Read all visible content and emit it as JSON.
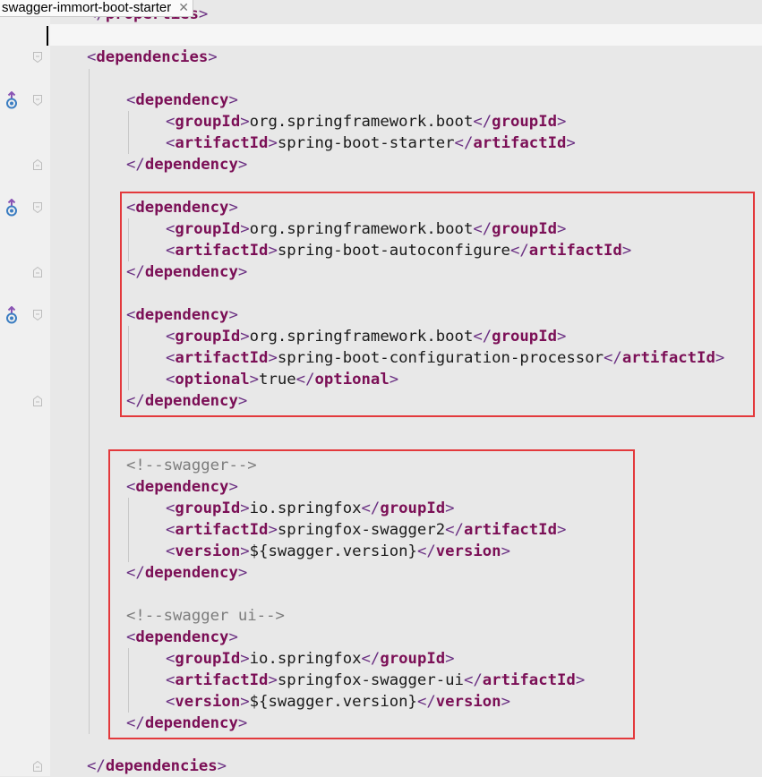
{
  "window": {
    "tab_title": "swagger-immort-boot-starter",
    "close_glyph": "✕"
  },
  "editor": {
    "colors": {
      "bracket": "#6a2f82",
      "tag": "#7b0f56",
      "comment": "#7c7c7c",
      "highlight_box": "#e3393c"
    },
    "lines": [
      {
        "indent": 0,
        "segments": [
          {
            "k": "b",
            "v": "</"
          },
          {
            "k": "t",
            "v": "properties"
          },
          {
            "k": "b",
            "v": ">"
          }
        ]
      },
      {
        "indent": 0,
        "segments": []
      },
      {
        "indent": 0,
        "segments": [
          {
            "k": "b",
            "v": "<"
          },
          {
            "k": "t",
            "v": "dependencies"
          },
          {
            "k": "b",
            "v": ">"
          }
        ]
      },
      {
        "indent": 0,
        "segments": []
      },
      {
        "indent": 1,
        "segments": [
          {
            "k": "b",
            "v": "<"
          },
          {
            "k": "t",
            "v": "dependency"
          },
          {
            "k": "b",
            "v": ">"
          }
        ]
      },
      {
        "indent": 2,
        "segments": [
          {
            "k": "b",
            "v": "<"
          },
          {
            "k": "t",
            "v": "groupId"
          },
          {
            "k": "b",
            "v": ">"
          },
          {
            "k": "x",
            "v": "org.springframework.boot"
          },
          {
            "k": "b",
            "v": "</"
          },
          {
            "k": "t",
            "v": "groupId"
          },
          {
            "k": "b",
            "v": ">"
          }
        ]
      },
      {
        "indent": 2,
        "segments": [
          {
            "k": "b",
            "v": "<"
          },
          {
            "k": "t",
            "v": "artifactId"
          },
          {
            "k": "b",
            "v": ">"
          },
          {
            "k": "x",
            "v": "spring-boot-starter"
          },
          {
            "k": "b",
            "v": "</"
          },
          {
            "k": "t",
            "v": "artifactId"
          },
          {
            "k": "b",
            "v": ">"
          }
        ]
      },
      {
        "indent": 1,
        "segments": [
          {
            "k": "b",
            "v": "</"
          },
          {
            "k": "t",
            "v": "dependency"
          },
          {
            "k": "b",
            "v": ">"
          }
        ]
      },
      {
        "indent": 0,
        "segments": []
      },
      {
        "indent": 1,
        "segments": [
          {
            "k": "b",
            "v": "<"
          },
          {
            "k": "t",
            "v": "dependency"
          },
          {
            "k": "b",
            "v": ">"
          }
        ]
      },
      {
        "indent": 2,
        "segments": [
          {
            "k": "b",
            "v": "<"
          },
          {
            "k": "t",
            "v": "groupId"
          },
          {
            "k": "b",
            "v": ">"
          },
          {
            "k": "x",
            "v": "org.springframework.boot"
          },
          {
            "k": "b",
            "v": "</"
          },
          {
            "k": "t",
            "v": "groupId"
          },
          {
            "k": "b",
            "v": ">"
          }
        ]
      },
      {
        "indent": 2,
        "segments": [
          {
            "k": "b",
            "v": "<"
          },
          {
            "k": "t",
            "v": "artifactId"
          },
          {
            "k": "b",
            "v": ">"
          },
          {
            "k": "x",
            "v": "spring-boot-autoconfigure"
          },
          {
            "k": "b",
            "v": "</"
          },
          {
            "k": "t",
            "v": "artifactId"
          },
          {
            "k": "b",
            "v": ">"
          }
        ]
      },
      {
        "indent": 1,
        "segments": [
          {
            "k": "b",
            "v": "</"
          },
          {
            "k": "t",
            "v": "dependency"
          },
          {
            "k": "b",
            "v": ">"
          }
        ]
      },
      {
        "indent": 0,
        "segments": []
      },
      {
        "indent": 1,
        "segments": [
          {
            "k": "b",
            "v": "<"
          },
          {
            "k": "t",
            "v": "dependency"
          },
          {
            "k": "b",
            "v": ">"
          }
        ]
      },
      {
        "indent": 2,
        "segments": [
          {
            "k": "b",
            "v": "<"
          },
          {
            "k": "t",
            "v": "groupId"
          },
          {
            "k": "b",
            "v": ">"
          },
          {
            "k": "x",
            "v": "org.springframework.boot"
          },
          {
            "k": "b",
            "v": "</"
          },
          {
            "k": "t",
            "v": "groupId"
          },
          {
            "k": "b",
            "v": ">"
          }
        ]
      },
      {
        "indent": 2,
        "segments": [
          {
            "k": "b",
            "v": "<"
          },
          {
            "k": "t",
            "v": "artifactId"
          },
          {
            "k": "b",
            "v": ">"
          },
          {
            "k": "x",
            "v": "spring-boot-configuration-processor"
          },
          {
            "k": "b",
            "v": "</"
          },
          {
            "k": "t",
            "v": "artifactId"
          },
          {
            "k": "b",
            "v": ">"
          }
        ]
      },
      {
        "indent": 2,
        "segments": [
          {
            "k": "b",
            "v": "<"
          },
          {
            "k": "t",
            "v": "optional"
          },
          {
            "k": "b",
            "v": ">"
          },
          {
            "k": "x",
            "v": "true"
          },
          {
            "k": "b",
            "v": "</"
          },
          {
            "k": "t",
            "v": "optional"
          },
          {
            "k": "b",
            "v": ">"
          }
        ]
      },
      {
        "indent": 1,
        "segments": [
          {
            "k": "b",
            "v": "</"
          },
          {
            "k": "t",
            "v": "dependency"
          },
          {
            "k": "b",
            "v": ">"
          }
        ]
      },
      {
        "indent": 0,
        "segments": []
      },
      {
        "indent": 0,
        "segments": []
      },
      {
        "indent": 1,
        "segments": [
          {
            "k": "c",
            "v": "<!--swagger-->"
          }
        ]
      },
      {
        "indent": 1,
        "segments": [
          {
            "k": "b",
            "v": "<"
          },
          {
            "k": "t",
            "v": "dependency"
          },
          {
            "k": "b",
            "v": ">"
          }
        ]
      },
      {
        "indent": 2,
        "segments": [
          {
            "k": "b",
            "v": "<"
          },
          {
            "k": "t",
            "v": "groupId"
          },
          {
            "k": "b",
            "v": ">"
          },
          {
            "k": "x",
            "v": "io.springfox"
          },
          {
            "k": "b",
            "v": "</"
          },
          {
            "k": "t",
            "v": "groupId"
          },
          {
            "k": "b",
            "v": ">"
          }
        ]
      },
      {
        "indent": 2,
        "segments": [
          {
            "k": "b",
            "v": "<"
          },
          {
            "k": "t",
            "v": "artifactId"
          },
          {
            "k": "b",
            "v": ">"
          },
          {
            "k": "x",
            "v": "springfox-swagger2"
          },
          {
            "k": "b",
            "v": "</"
          },
          {
            "k": "t",
            "v": "artifactId"
          },
          {
            "k": "b",
            "v": ">"
          }
        ]
      },
      {
        "indent": 2,
        "segments": [
          {
            "k": "b",
            "v": "<"
          },
          {
            "k": "t",
            "v": "version"
          },
          {
            "k": "b",
            "v": ">"
          },
          {
            "k": "x",
            "v": "${swagger.version}"
          },
          {
            "k": "b",
            "v": "</"
          },
          {
            "k": "t",
            "v": "version"
          },
          {
            "k": "b",
            "v": ">"
          }
        ]
      },
      {
        "indent": 1,
        "segments": [
          {
            "k": "b",
            "v": "</"
          },
          {
            "k": "t",
            "v": "dependency"
          },
          {
            "k": "b",
            "v": ">"
          }
        ]
      },
      {
        "indent": 0,
        "segments": []
      },
      {
        "indent": 1,
        "segments": [
          {
            "k": "c",
            "v": "<!--swagger ui-->"
          }
        ]
      },
      {
        "indent": 1,
        "segments": [
          {
            "k": "b",
            "v": "<"
          },
          {
            "k": "t",
            "v": "dependency"
          },
          {
            "k": "b",
            "v": ">"
          }
        ]
      },
      {
        "indent": 2,
        "segments": [
          {
            "k": "b",
            "v": "<"
          },
          {
            "k": "t",
            "v": "groupId"
          },
          {
            "k": "b",
            "v": ">"
          },
          {
            "k": "x",
            "v": "io.springfox"
          },
          {
            "k": "b",
            "v": "</"
          },
          {
            "k": "t",
            "v": "groupId"
          },
          {
            "k": "b",
            "v": ">"
          }
        ]
      },
      {
        "indent": 2,
        "segments": [
          {
            "k": "b",
            "v": "<"
          },
          {
            "k": "t",
            "v": "artifactId"
          },
          {
            "k": "b",
            "v": ">"
          },
          {
            "k": "x",
            "v": "springfox-swagger-ui"
          },
          {
            "k": "b",
            "v": "</"
          },
          {
            "k": "t",
            "v": "artifactId"
          },
          {
            "k": "b",
            "v": ">"
          }
        ]
      },
      {
        "indent": 2,
        "segments": [
          {
            "k": "b",
            "v": "<"
          },
          {
            "k": "t",
            "v": "version"
          },
          {
            "k": "b",
            "v": ">"
          },
          {
            "k": "x",
            "v": "${swagger.version}"
          },
          {
            "k": "b",
            "v": "</"
          },
          {
            "k": "t",
            "v": "version"
          },
          {
            "k": "b",
            "v": ">"
          }
        ]
      },
      {
        "indent": 1,
        "segments": [
          {
            "k": "b",
            "v": "</"
          },
          {
            "k": "t",
            "v": "dependency"
          },
          {
            "k": "b",
            "v": ">"
          }
        ]
      },
      {
        "indent": 0,
        "segments": []
      },
      {
        "indent": 0,
        "segments": [
          {
            "k": "b",
            "v": "</"
          },
          {
            "k": "t",
            "v": "dependencies"
          },
          {
            "k": "b",
            "v": ">"
          }
        ]
      }
    ],
    "gutter": {
      "fold_open_lines": [
        2,
        4,
        9,
        14
      ],
      "fold_close_lines": [
        7,
        12,
        18,
        35
      ],
      "maven_dependency_icon_lines": [
        4,
        9,
        14
      ],
      "maven_dependency_icon": "maven-dependency-icon"
    },
    "highlight_boxes": [
      {
        "label": "spring-boot-dependencies-box",
        "from_line": 9,
        "to_line": 18
      },
      {
        "label": "swagger-dependencies-box",
        "from_line": 21,
        "to_line": 33
      }
    ]
  }
}
